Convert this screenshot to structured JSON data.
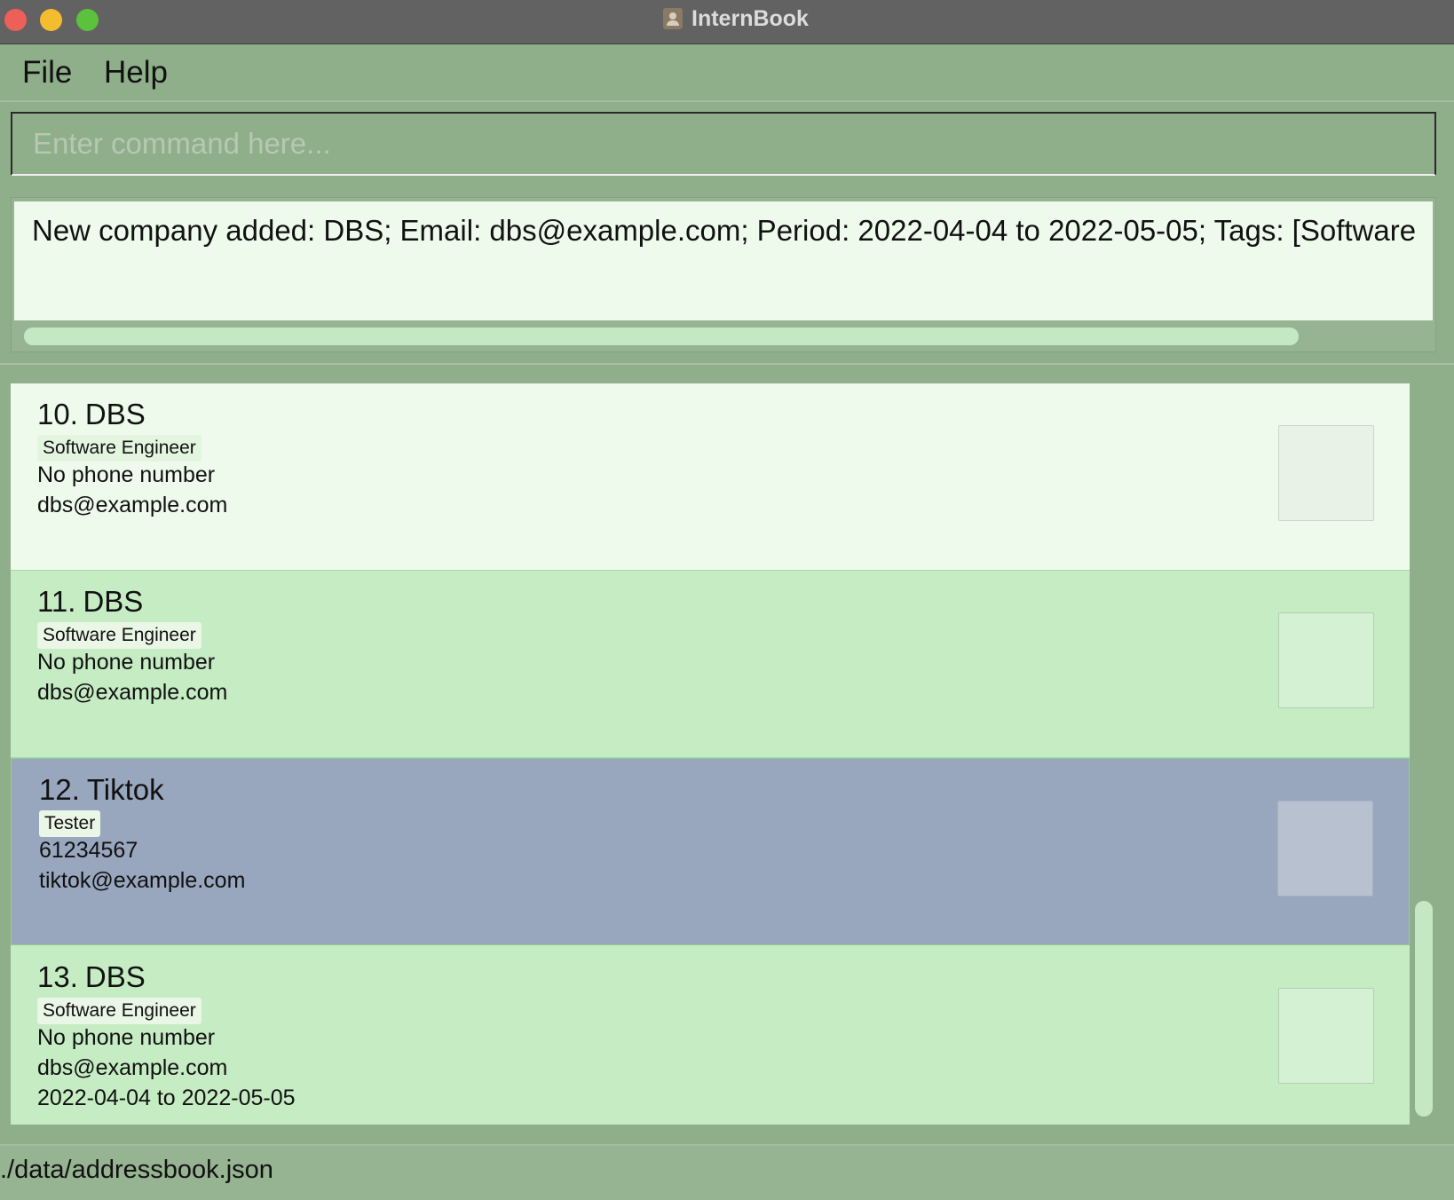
{
  "window": {
    "title": "InternBook",
    "app_icon": "address-book-icon"
  },
  "menu": {
    "items": [
      "File",
      "Help"
    ]
  },
  "command": {
    "placeholder": "Enter command here...",
    "value": ""
  },
  "result": {
    "text": "New company added: DBS; Email: dbs@example.com; Period: 2022-04-04 to 2022-05-05; Tags: [Software"
  },
  "companies": [
    {
      "index": "10.",
      "name": "DBS",
      "tag": "Software Engineer",
      "phone": "No phone number",
      "email": "dbs@example.com",
      "period": ""
    },
    {
      "index": "11.",
      "name": "DBS",
      "tag": "Software Engineer",
      "phone": "No phone number",
      "email": "dbs@example.com",
      "period": ""
    },
    {
      "index": "12.",
      "name": "Tiktok",
      "tag": "Tester",
      "phone": "61234567",
      "email": "tiktok@example.com",
      "period": "",
      "selected": true
    },
    {
      "index": "13.",
      "name": "DBS",
      "tag": "Software Engineer",
      "phone": "No phone number",
      "email": "dbs@example.com",
      "period": "2022-04-04 to 2022-05-05"
    }
  ],
  "status": {
    "path": "./data/addressbook.json"
  },
  "colors": {
    "background": "#8fae8a",
    "card_even": "#eefbec",
    "card_odd": "#c6ecc4",
    "card_selected": "#98a6be",
    "titlebar": "#626262"
  }
}
